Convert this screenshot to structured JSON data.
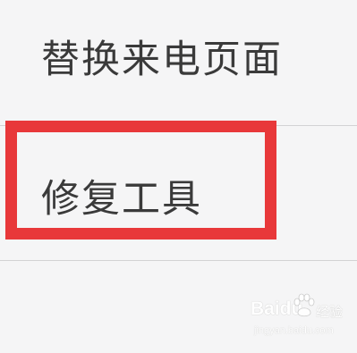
{
  "menu": {
    "items": [
      {
        "label": "替换来电页面"
      },
      {
        "label": "修复工具"
      }
    ]
  },
  "watermark": {
    "brand": "Baidu",
    "suffix": "经验",
    "sub": "jingyan.baidu.com"
  },
  "colors": {
    "background": "#f5f5f6",
    "text": "#3a3a3a",
    "divider": "#d2d2d4",
    "highlight": "#e8383a"
  },
  "icons": {
    "watermark_logo": "paw-icon"
  }
}
